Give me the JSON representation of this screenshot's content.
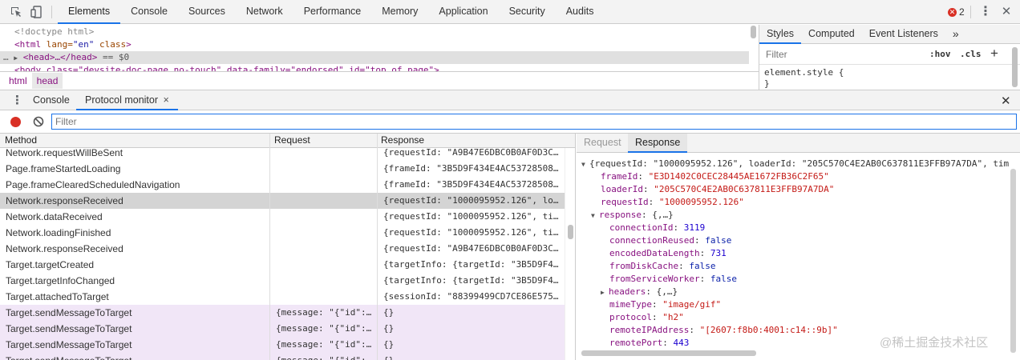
{
  "toolbar": {
    "tabs": [
      "Elements",
      "Console",
      "Sources",
      "Network",
      "Performance",
      "Memory",
      "Application",
      "Security",
      "Audits"
    ],
    "active_tab": "Elements",
    "error_count": "2"
  },
  "elements": {
    "lines": {
      "doctype": "<!doctype html>",
      "html_open": "<html",
      "html_lang_attr": " lang=",
      "html_lang_val": "\"en\"",
      "html_class_attr": " class",
      "html_close": ">",
      "head": "<head>…</head>",
      "head_suffix": " == $0",
      "body_partial": "<body class=\"devsite-doc-page no-touch\" data-family=\"endorsed\" id=\"top_of_page\">"
    },
    "breadcrumbs": [
      "html",
      "head"
    ]
  },
  "styles": {
    "tabs": [
      "Styles",
      "Computed",
      "Event Listeners"
    ],
    "more": "»",
    "filter_placeholder": "Filter",
    "hov": ":hov",
    "cls": ".cls",
    "add": "+",
    "element_style": "element.style {",
    "element_style_close": "}"
  },
  "drawer": {
    "tabs": [
      "Console",
      "Protocol monitor"
    ],
    "active_tab": "Protocol monitor",
    "close_tab": "×"
  },
  "protocol_monitor": {
    "filter_placeholder": "Filter",
    "columns": [
      "Method",
      "Request",
      "Response"
    ],
    "rows": [
      {
        "method": "Network.requestWillBeSent",
        "request": "",
        "response": "{requestId: \"A9B47E6DBC0B0AF0D3C…",
        "state": "normal"
      },
      {
        "method": "Page.frameStartedLoading",
        "request": "",
        "response": "{frameId: \"3B5D9F434E4AC53728508…",
        "state": "normal"
      },
      {
        "method": "Page.frameClearedScheduledNavigation",
        "request": "",
        "response": "{frameId: \"3B5D9F434E4AC53728508…",
        "state": "normal"
      },
      {
        "method": "Network.responseReceived",
        "request": "",
        "response": "{requestId: \"1000095952.126\", lo…",
        "state": "selected"
      },
      {
        "method": "Network.dataReceived",
        "request": "",
        "response": "{requestId: \"1000095952.126\", ti…",
        "state": "normal"
      },
      {
        "method": "Network.loadingFinished",
        "request": "",
        "response": "{requestId: \"1000095952.126\", ti…",
        "state": "normal"
      },
      {
        "method": "Network.responseReceived",
        "request": "",
        "response": "{requestId: \"A9B47E6DBC0B0AF0D3C…",
        "state": "normal"
      },
      {
        "method": "Target.targetCreated",
        "request": "",
        "response": "{targetInfo: {targetId: \"3B5D9F4…",
        "state": "normal"
      },
      {
        "method": "Target.targetInfoChanged",
        "request": "",
        "response": "{targetInfo: {targetId: \"3B5D9F4…",
        "state": "normal"
      },
      {
        "method": "Target.attachedToTarget",
        "request": "",
        "response": "{sessionId: \"88399499CD7CE86E575…",
        "state": "normal"
      },
      {
        "method": "Target.sendMessageToTarget",
        "request": "{message: \"{\"id\":…",
        "response": "{}",
        "state": "sent"
      },
      {
        "method": "Target.sendMessageToTarget",
        "request": "{message: \"{\"id\":…",
        "response": "{}",
        "state": "sent"
      },
      {
        "method": "Target.sendMessageToTarget",
        "request": "{message: \"{\"id\":…",
        "response": "{}",
        "state": "sent"
      },
      {
        "method": "Target.sendMessageToTarget",
        "request": "{message: \"{\"id\":…",
        "response": "{}",
        "state": "sent"
      }
    ]
  },
  "detail": {
    "tabs": [
      "Request",
      "Response"
    ],
    "active_tab": "Response",
    "summary": "{requestId: \"1000095952.126\", loaderId: \"205C570C4E2AB0C637811E3FFB97A7DA\", tim",
    "fields": [
      {
        "key": "frameId",
        "value": "\"E3D1402C0CEC28445AE1672FB36C2F65\"",
        "type": "str"
      },
      {
        "key": "loaderId",
        "value": "\"205C570C4E2AB0C637811E3FFB97A7DA\"",
        "type": "str"
      },
      {
        "key": "requestId",
        "value": "\"1000095952.126\"",
        "type": "str"
      }
    ],
    "response_key": "response",
    "response_summary": "{,…}",
    "response_fields": [
      {
        "key": "connectionId",
        "value": "3119",
        "type": "num"
      },
      {
        "key": "connectionReused",
        "value": "false",
        "type": "kw"
      },
      {
        "key": "encodedDataLength",
        "value": "731",
        "type": "num"
      },
      {
        "key": "fromDiskCache",
        "value": "false",
        "type": "kw"
      },
      {
        "key": "fromServiceWorker",
        "value": "false",
        "type": "kw"
      },
      {
        "key": "headers",
        "value": "{,…}",
        "type": "obj"
      },
      {
        "key": "mimeType",
        "value": "\"image/gif\"",
        "type": "str"
      },
      {
        "key": "protocol",
        "value": "\"h2\"",
        "type": "str"
      },
      {
        "key": "remoteIPAddress",
        "value": "\"[2607:f8b0:4001:c14::9b]\"",
        "type": "str"
      },
      {
        "key": "remotePort",
        "value": "443",
        "type": "num"
      }
    ]
  },
  "watermark": "@稀土掘金技术社区"
}
